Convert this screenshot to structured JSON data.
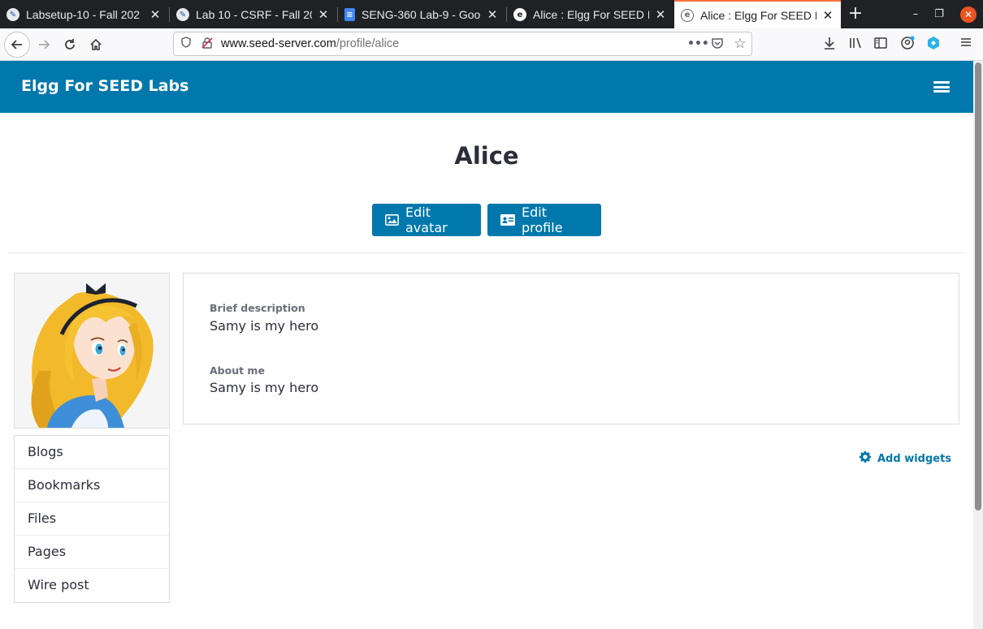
{
  "browser": {
    "tabs": [
      {
        "title": "Labsetup-10 - Fall 202",
        "active": false
      },
      {
        "title": "Lab 10 - CSRF - Fall 20",
        "active": false
      },
      {
        "title": "SENG-360 Lab-9 - Goo",
        "active": false
      },
      {
        "title": "Alice : Elgg For SEED L",
        "active": false
      },
      {
        "title": "Alice : Elgg For SEED L",
        "active": true
      }
    ],
    "url_host": "www.seed-server.com",
    "url_path": "/profile/alice"
  },
  "site": {
    "title": "Elgg For SEED Labs",
    "accent": "#0078ac"
  },
  "profile": {
    "name": "Alice",
    "edit_avatar_label": "Edit avatar",
    "edit_profile_label": "Edit profile",
    "fields": [
      {
        "label": "Brief description",
        "value": "Samy is my hero"
      },
      {
        "label": "About me",
        "value": "Samy is my hero"
      }
    ]
  },
  "owner_menu": [
    "Blogs",
    "Bookmarks",
    "Files",
    "Pages",
    "Wire post"
  ],
  "widgets": {
    "add_label": "Add widgets"
  }
}
